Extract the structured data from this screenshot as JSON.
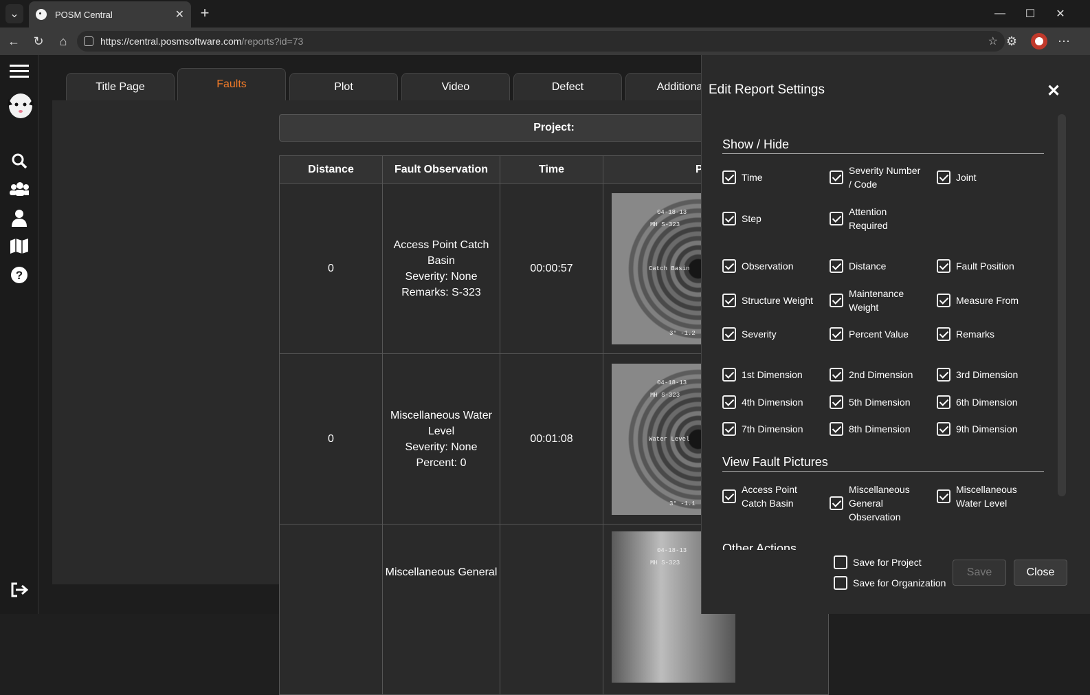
{
  "browser": {
    "tab_title": "POSM Central",
    "url_host": "https://central.posmsoftware.com",
    "url_path": "/reports?id=73"
  },
  "report_tabs": [
    "Title Page",
    "Faults",
    "Plot",
    "Video",
    "Defect",
    "Additiona"
  ],
  "project_label": "Project:",
  "table": {
    "headers": [
      "Distance",
      "Fault Observation",
      "Time",
      "P"
    ],
    "rows": [
      {
        "distance": "0",
        "obs_title": "Access Point Catch Basin",
        "severity": "Severity: None",
        "extra": "Remarks: S-323",
        "time": "00:00:57",
        "pic_text": "Catch Basin",
        "pic_date": "04-18-13",
        "pic_mh": "MH S-323",
        "pic_bottom": "3° -1.2"
      },
      {
        "distance": "0",
        "obs_title": "Miscellaneous Water Level",
        "severity": "Severity: None",
        "extra": "Percent: 0",
        "time": "00:01:08",
        "pic_text": "Water Level",
        "pic_date": "04-18-13",
        "pic_mh": "MH S-323",
        "pic_bottom": "3° -1.1"
      },
      {
        "distance": "",
        "obs_title": "Miscellaneous General",
        "severity": "",
        "extra": "",
        "time": "",
        "pic_text": "",
        "pic_date": "04-18-13",
        "pic_mh": "MH S-323",
        "pic_bottom": ""
      }
    ]
  },
  "drawer": {
    "title": "Edit Report Settings",
    "show_hide_title": "Show / Hide",
    "fields": [
      [
        "Time",
        "Severity Number / Code",
        "Joint"
      ],
      [
        "Step",
        "Attention Required",
        ""
      ],
      [
        "Observation",
        "Distance",
        "Fault Position"
      ],
      [
        "Structure Weight",
        "Maintenance Weight",
        "Measure From"
      ],
      [
        "Severity",
        "Percent Value",
        "Remarks"
      ],
      [
        "1st Dimension",
        "2nd Dimension",
        "3rd Dimension"
      ],
      [
        "4th Dimension",
        "5th Dimension",
        "6th Dimension"
      ],
      [
        "7th Dimension",
        "8th Dimension",
        "9th Dimension"
      ]
    ],
    "pictures_title": "View Fault Pictures",
    "pictures": [
      "Access Point Catch Basin",
      "Miscellaneous General Observation",
      "Miscellaneous Water Level"
    ],
    "other_title": "Other Actions",
    "save_project": "Save for Project",
    "save_org": "Save for Organization",
    "save_btn": "Save",
    "close_btn": "Close"
  }
}
